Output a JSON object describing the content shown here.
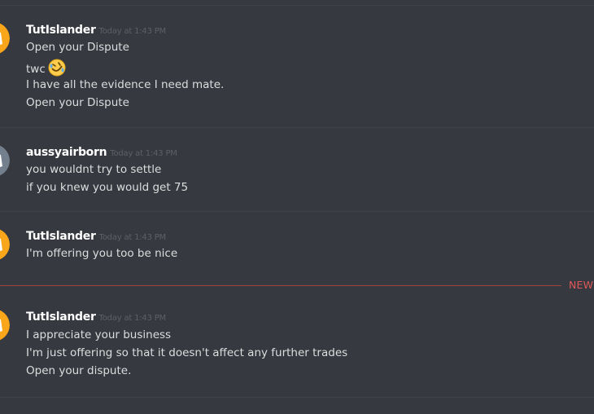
{
  "colors": {
    "background": "#36393f",
    "username": "#ffffff",
    "timestamp": "#5d6066",
    "message_text": "#dcddde",
    "divider": "#40434a",
    "new_marker": "#e0585a",
    "avatar_orange": "#faa61a",
    "avatar_gray": "#747f8d"
  },
  "messages": [
    {
      "username": "TutIslander",
      "timestamp": "Today at 1:43 PM",
      "avatar_icon": "discord-logo-icon",
      "avatar_color": "orange",
      "lines": [
        "Open your Dispute",
        "twc",
        "I have all the evidence I need mate.",
        "Open your Dispute"
      ],
      "emoji": "rolling-on-floor-laughing-icon"
    },
    {
      "username": "aussyairborn",
      "timestamp": "Today at 1:43 PM",
      "avatar_icon": "discord-logo-icon",
      "avatar_color": "gray",
      "lines": [
        "you wouldnt try to settle",
        "if you knew you would get 75"
      ]
    },
    {
      "username": "TutIslander",
      "timestamp": "Today at 1:43 PM",
      "avatar_icon": "discord-logo-icon",
      "avatar_color": "orange",
      "lines": [
        "I'm offering you too be nice"
      ]
    },
    {
      "username": "TutIslander",
      "timestamp": "Today at 1:43 PM",
      "avatar_icon": "discord-logo-icon",
      "avatar_color": "orange",
      "lines": [
        "I appreciate your business",
        "I'm just offering so that it doesn't affect any further trades",
        "Open your dispute."
      ]
    }
  ],
  "new_divider": {
    "label": "NEW"
  }
}
